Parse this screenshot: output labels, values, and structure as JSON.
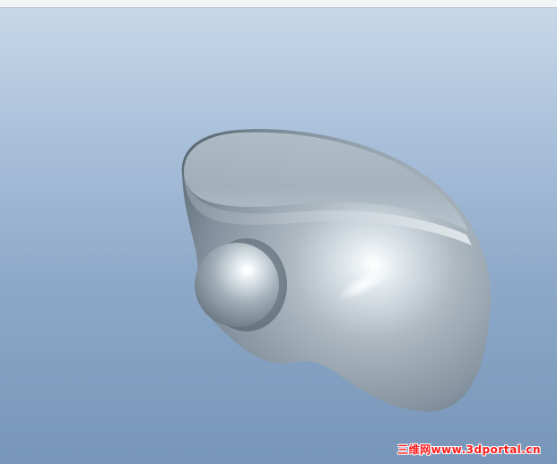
{
  "viewport": {
    "background_top": "#c9d9e9",
    "background_bottom": "#7896b9",
    "top_border_color": "#f2f4f6"
  },
  "model": {
    "surface_base": "#9aa7b0",
    "surface_highlight": "#ffffff",
    "surface_shadow": "#4b5a66"
  },
  "watermark": {
    "text": "三维网www.3dportal.cn",
    "color": "#ff1a1a"
  }
}
